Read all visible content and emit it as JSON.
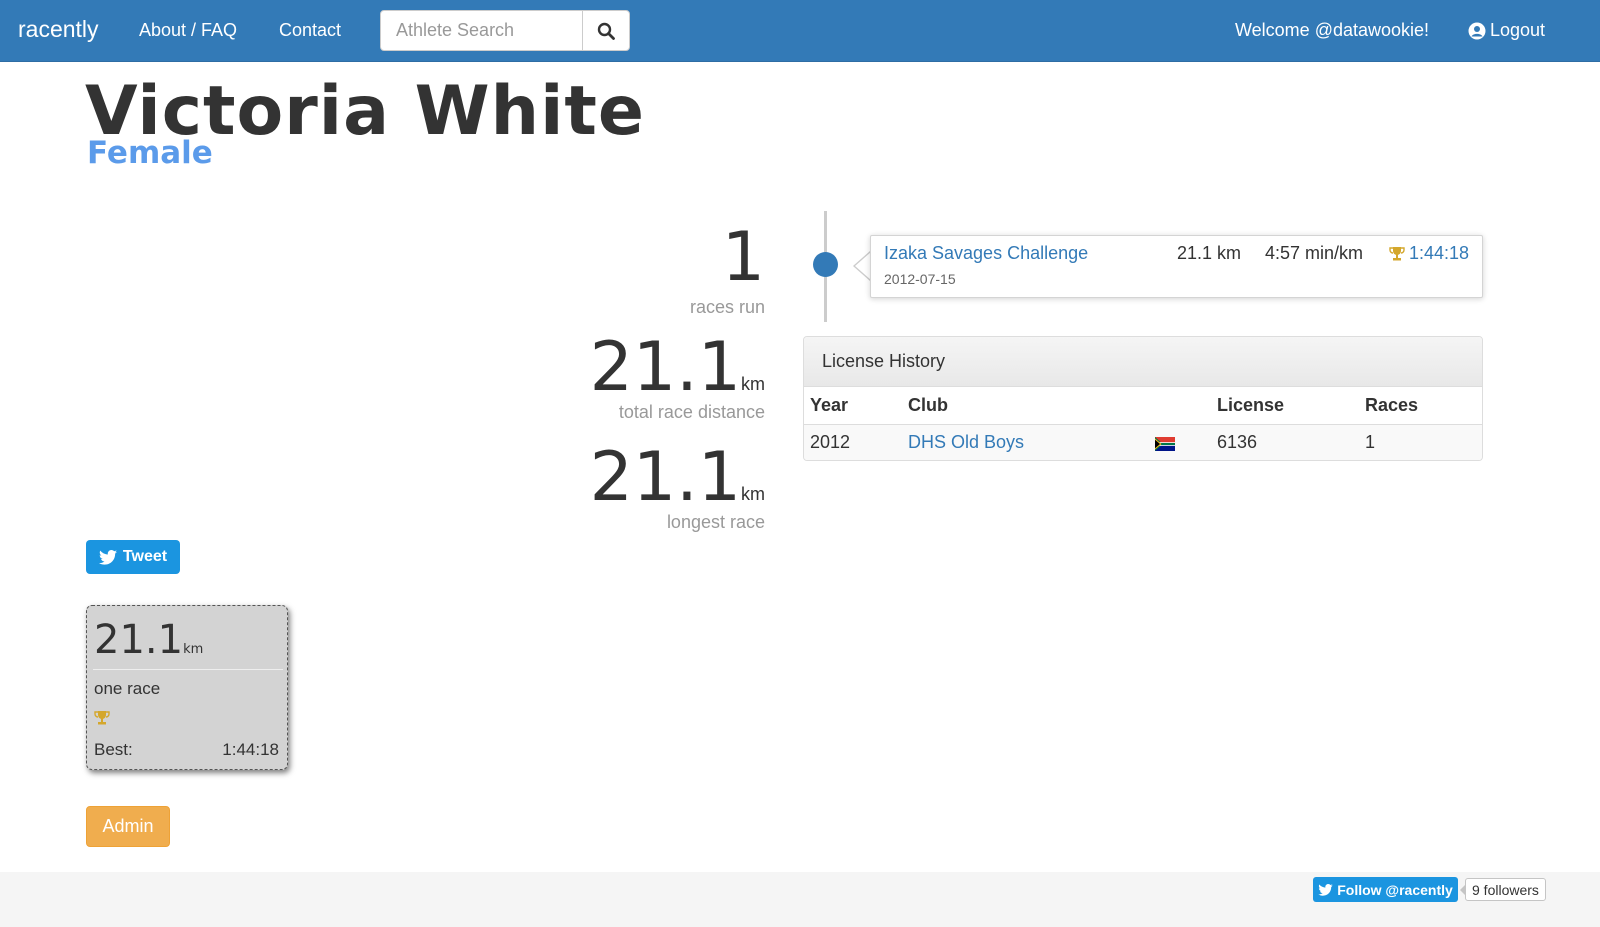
{
  "navbar": {
    "brand": "racently",
    "links": [
      {
        "label": "About / FAQ"
      },
      {
        "label": "Contact"
      }
    ],
    "search_placeholder": "Athlete Search",
    "welcome": "Welcome @datawookie!",
    "logout": "Logout"
  },
  "athlete": {
    "name": "Victoria White",
    "gender": "Female"
  },
  "stats": {
    "races_run": {
      "value": "1",
      "label": "races run"
    },
    "total_distance": {
      "value": "21.1",
      "unit": "km",
      "label": "total race distance"
    },
    "longest_race": {
      "value": "21.1",
      "unit": "km",
      "label": "longest race"
    }
  },
  "timeline": [
    {
      "name": "Izaka Savages Challenge",
      "date": "2012-07-15",
      "distance": "21.1 km",
      "pace": "4:57 min/km",
      "time": "1:44:18"
    }
  ],
  "license_history": {
    "title": "License History",
    "columns": [
      "Year",
      "Club",
      "",
      "License",
      "Races"
    ],
    "rows": [
      {
        "year": "2012",
        "club": "DHS Old Boys",
        "license": "6136",
        "races": "1"
      }
    ]
  },
  "tweet": {
    "label": "Tweet"
  },
  "badge": {
    "distance": "21.1",
    "unit": "km",
    "races": "one race",
    "best_label": "Best:",
    "best_time": "1:44:18"
  },
  "admin": {
    "label": "Admin"
  },
  "footer": {
    "follow_label": "Follow @racently",
    "followers": "9 followers"
  },
  "colors": {
    "primary": "#337ab7",
    "gender": "#5b9bea",
    "trophy": "#d4a72c",
    "admin": "#f0ad4e",
    "twitter": "#1b95e0"
  },
  "icons": {
    "search": "search-icon",
    "logout": "user-circle-icon",
    "trophy": "trophy-icon",
    "twitter": "twitter-bird-icon",
    "flag": "south-africa-flag-icon"
  }
}
